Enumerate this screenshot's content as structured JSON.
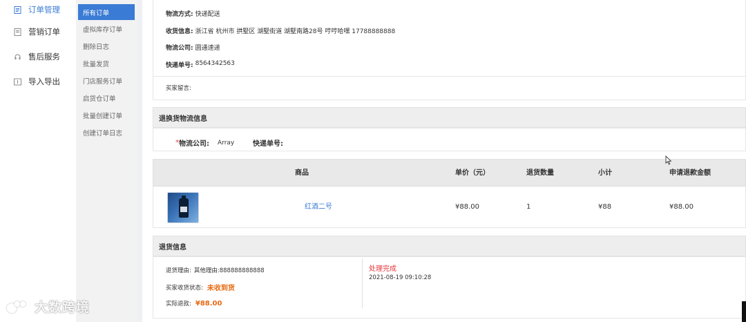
{
  "nav_primary": [
    {
      "label": "订单管理",
      "icon": "document-icon",
      "active": true
    },
    {
      "label": "营销订单",
      "icon": "document-icon",
      "active": false
    },
    {
      "label": "售后服务",
      "icon": "headset-icon",
      "active": false
    },
    {
      "label": "导入导出",
      "icon": "import-export-icon",
      "active": false
    }
  ],
  "nav_secondary": [
    {
      "label": "所有订单",
      "active": true
    },
    {
      "label": "虚拟库存订单"
    },
    {
      "label": "删除日志"
    },
    {
      "label": "批量发货"
    },
    {
      "label": "门店服务订单"
    },
    {
      "label": "启货仓订单"
    },
    {
      "label": "批量创建订单"
    },
    {
      "label": "创建订单日志"
    }
  ],
  "shipping": {
    "method_key": "物流方式:",
    "method_val": "快递配送",
    "address_key": "收货信息:",
    "address_val": "浙江省 杭州市 拱墅区 湖墅街道 湖墅南路28号 哼哼哈嘿 17788888888",
    "company_key": "物流公司:",
    "company_val": "圆通速递",
    "tracking_key": "快递单号:",
    "tracking_val": "8564342563",
    "buyer_note_key": "买家留言:"
  },
  "return_logistics": {
    "title": "退换货物流信息",
    "company_required": "*",
    "company_label": "物流公司:",
    "company_value": "Array",
    "tracking_label": "快递单号:"
  },
  "items_table": {
    "headers": {
      "product": "商品",
      "unit_price": "单价（元）",
      "return_qty": "退货数量",
      "subtotal": "小计",
      "refund_amount": "申请退款金额"
    },
    "rows": [
      {
        "name": "红酒二号",
        "unit_price": "¥88.00",
        "qty": "1",
        "subtotal": "¥88",
        "refund": "¥88.00"
      }
    ]
  },
  "return_info": {
    "title": "退货信息",
    "reason_key": "退货理由:",
    "reason_val": "其他理由:888888888888",
    "receipt_key": "买家收货状态:",
    "receipt_val": "未收到货",
    "refund_key": "实际退款:",
    "refund_val": "¥88.00",
    "status": "处理完成",
    "timestamp": "2021-08-19 09:10:28"
  },
  "watermark": {
    "text": "大数跨境"
  },
  "colors": {
    "accent": "#3a7bd5",
    "link": "#3a7bd5",
    "danger": "#e4393c",
    "orange": "#e86a12"
  }
}
